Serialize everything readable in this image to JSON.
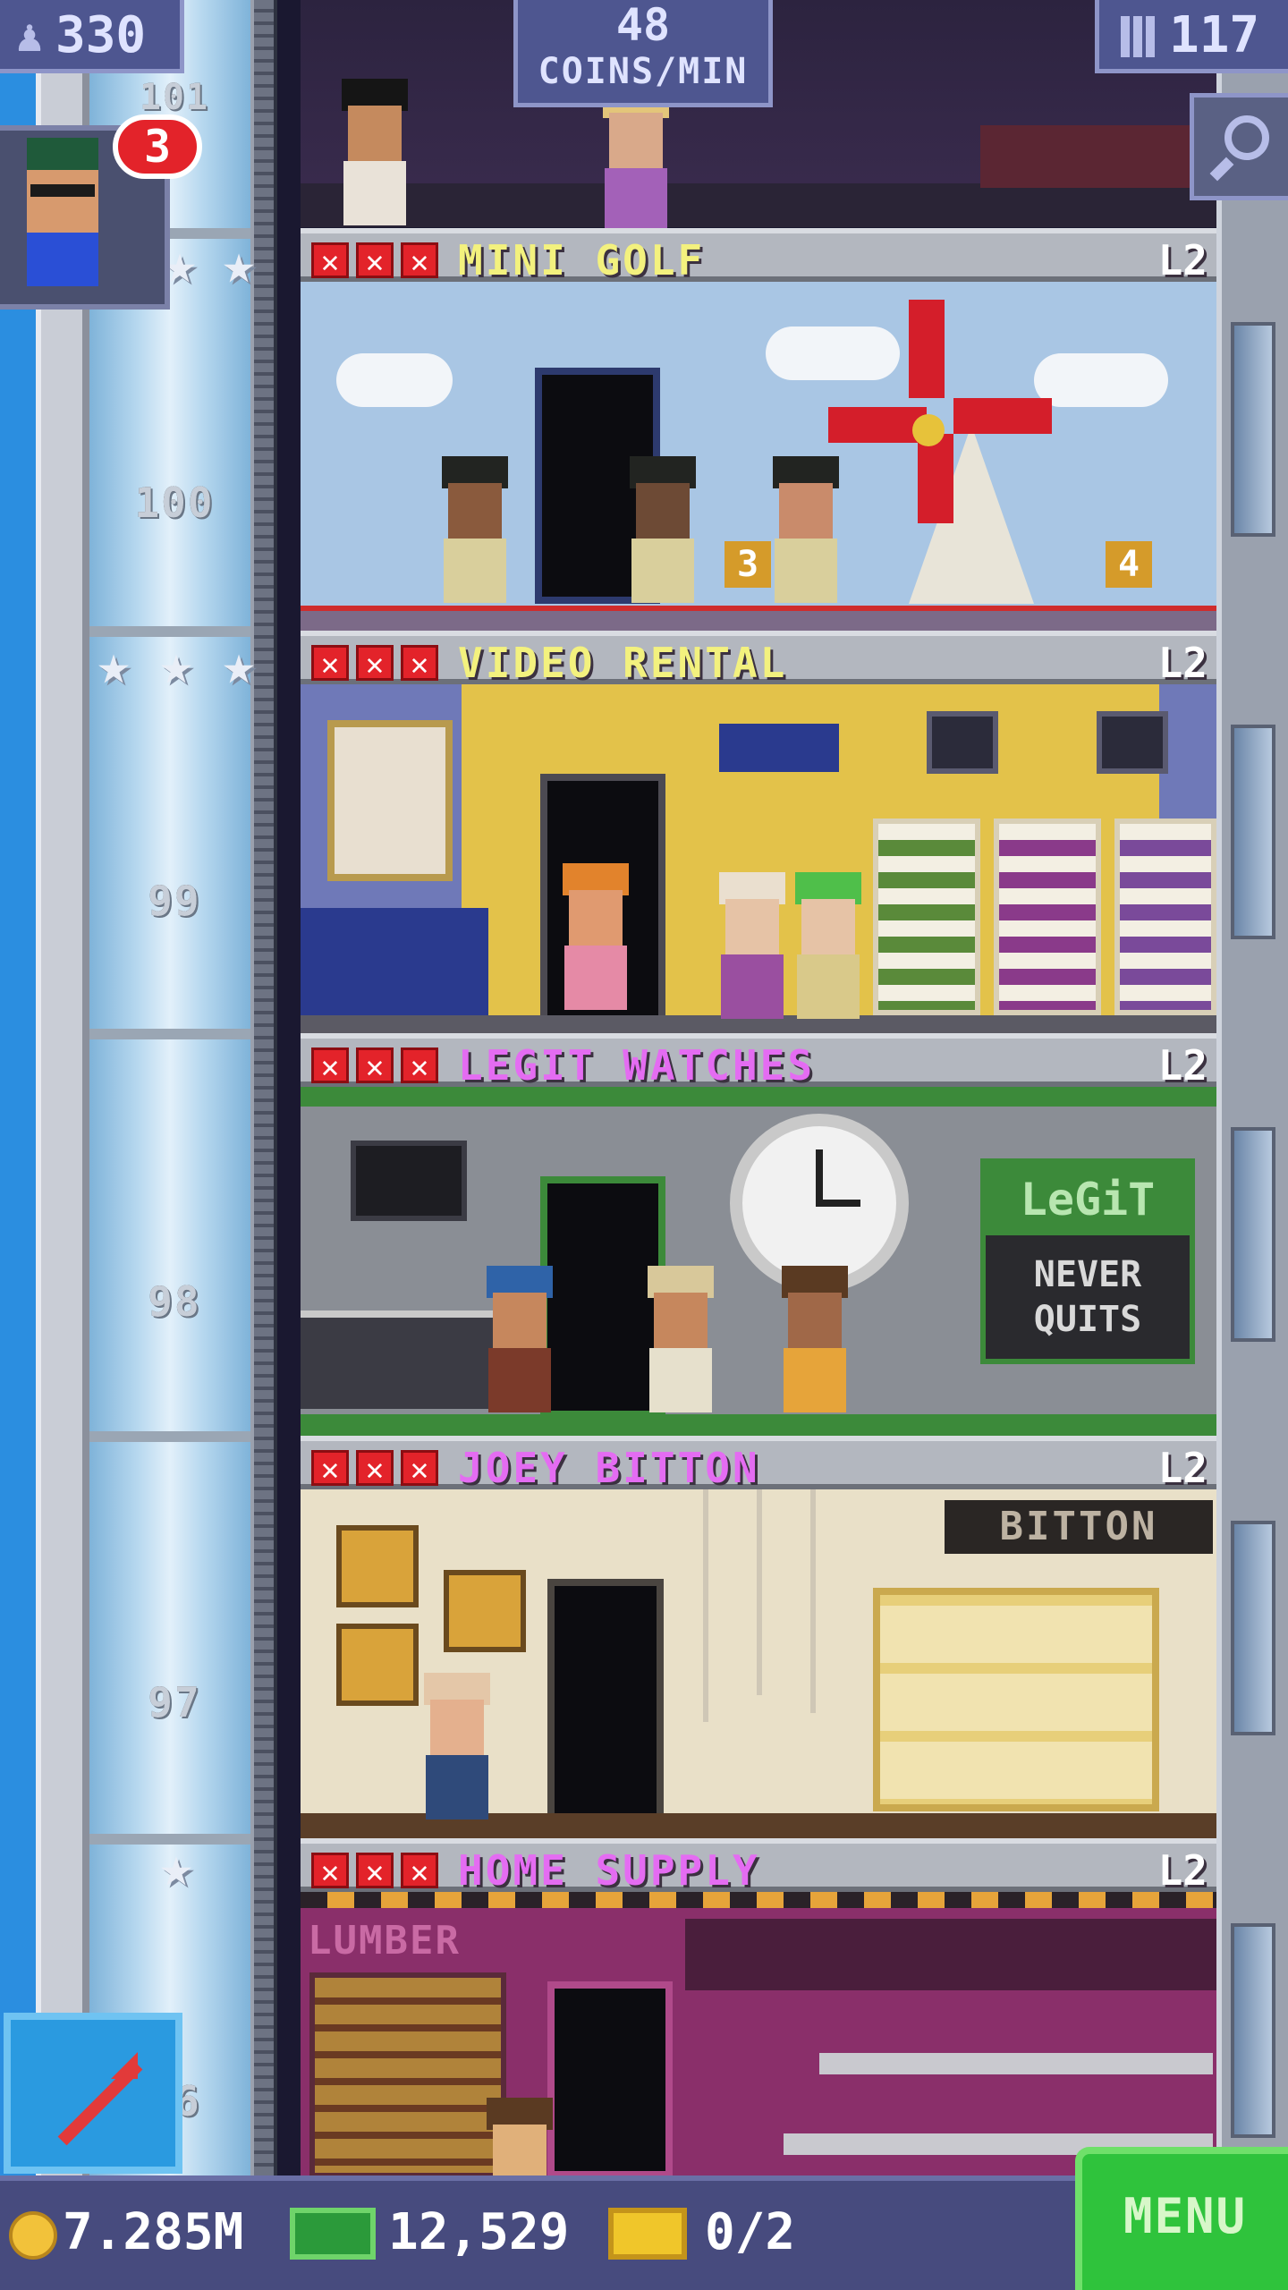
{
  "hud": {
    "population": "330",
    "coins_rate_value": "48",
    "coins_rate_unit": "COINS/MIN",
    "tower_floors": "117",
    "visitor_badge": "3",
    "partial_floor_number": "101"
  },
  "floors": [
    {
      "name": "MINI GOLF",
      "level": "L2",
      "number": "100",
      "name_color": "#f3f17e",
      "stars": 3
    },
    {
      "name": "VIDEO RENTAL",
      "level": "L2",
      "number": "99",
      "name_color": "#f3f17e",
      "stars": 3
    },
    {
      "name": "LEGIT WATCHES",
      "level": "L2",
      "number": "98",
      "name_color": "#e46cf2",
      "stars": 0
    },
    {
      "name": "JOEY BITTON",
      "level": "L2",
      "number": "97",
      "name_color": "#e46cf2",
      "stars": 0
    },
    {
      "name": "HOME SUPPLY",
      "level": "L2",
      "number": "96",
      "name_color": "#e46cf2",
      "stars": 1
    }
  ],
  "room_signs": {
    "mini_golf_hole_a": "3",
    "mini_golf_hole_b": "4",
    "watch_sign_top": "LeGiT",
    "watch_sign_bottom_1": "NEVER",
    "watch_sign_bottom_2": "QUITS",
    "bitton_sign": "BITTON",
    "lumber_sign": "LUMBER"
  },
  "status_bar": {
    "coins": "7.285M",
    "bux": "12,529",
    "tickets": "0/2",
    "menu_label": "MENU"
  },
  "icons": [
    "person-icon",
    "building-icon",
    "zoom-icon",
    "coin-icon",
    "bux-icon",
    "ticket-icon",
    "rocket-arrow-icon",
    "star-icon"
  ],
  "colors": {
    "hud_bg": "#4e5690",
    "menu_green": "#2fc33c",
    "x_red": "#e3232a"
  }
}
